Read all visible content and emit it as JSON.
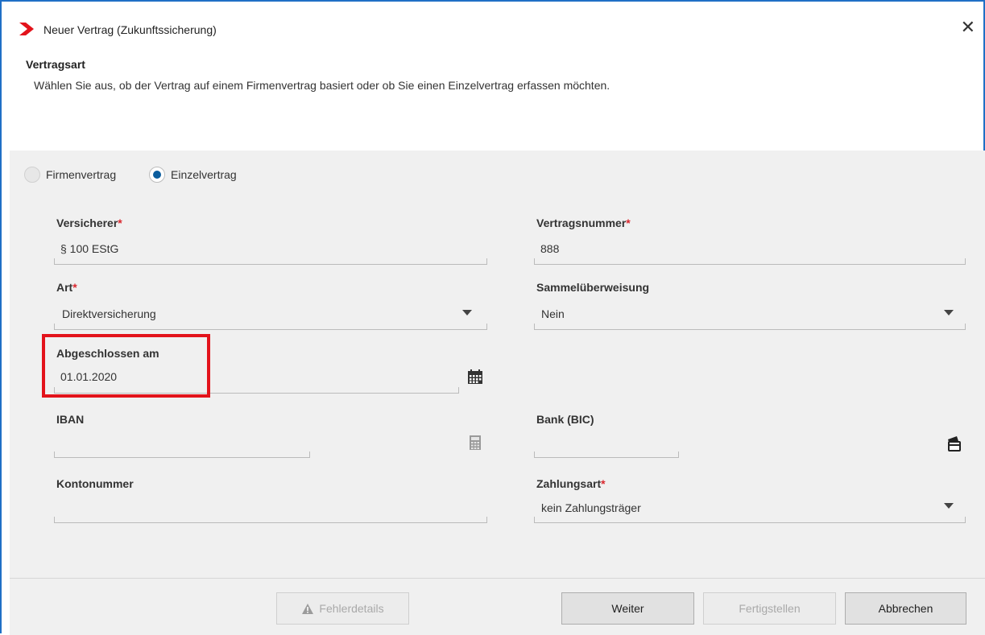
{
  "window": {
    "title": "Neuer Vertrag (Zukunftssicherung)",
    "close_label": "✕"
  },
  "header": {
    "section_title": "Vertragsart",
    "description": "Wählen Sie aus, ob der Vertrag auf einem Firmenvertrag basiert oder ob Sie einen Einzelvertrag erfassen möchten."
  },
  "contract_type": {
    "options": [
      "Firmenvertrag",
      "Einzelvertrag"
    ],
    "selected": "Einzelvertrag"
  },
  "fields": {
    "versicherer": {
      "label": "Versicherer",
      "required_mark": "*",
      "value": "§ 100 EStG"
    },
    "vertragsnummer": {
      "label": "Vertragsnummer",
      "required_mark": "*",
      "value": "888"
    },
    "art": {
      "label": "Art",
      "required_mark": "*",
      "value": "Direktversicherung"
    },
    "sammelueberweisung": {
      "label": "Sammelüberweisung",
      "value": "Nein"
    },
    "abgeschlossen_am": {
      "label": "Abgeschlossen am",
      "value": "01.01.2020"
    },
    "iban": {
      "label": "IBAN",
      "value": ""
    },
    "bank_bic": {
      "label": "Bank (BIC)",
      "value": ""
    },
    "kontonummer": {
      "label": "Kontonummer",
      "value": ""
    },
    "zahlungsart": {
      "label": "Zahlungsart",
      "required_mark": "*",
      "value": "kein Zahlungsträger"
    }
  },
  "icons": {
    "logo": "red-chevron-logo",
    "calendar": "calendar-icon",
    "calculator": "calculator-icon",
    "bank": "bank-card-icon",
    "warning": "warning-triangle-icon",
    "dropdown": "chevron-down-icon"
  },
  "colors": {
    "accent": "#0b5d9e",
    "required": "#d9272e",
    "highlight": "#e3131b",
    "border": "#1f6fc6",
    "logo": "#e3131b"
  },
  "footer": {
    "fehlerdetails": "Fehlerdetails",
    "weiter": "Weiter",
    "fertigstellen": "Fertigstellen",
    "abbrechen": "Abbrechen"
  }
}
